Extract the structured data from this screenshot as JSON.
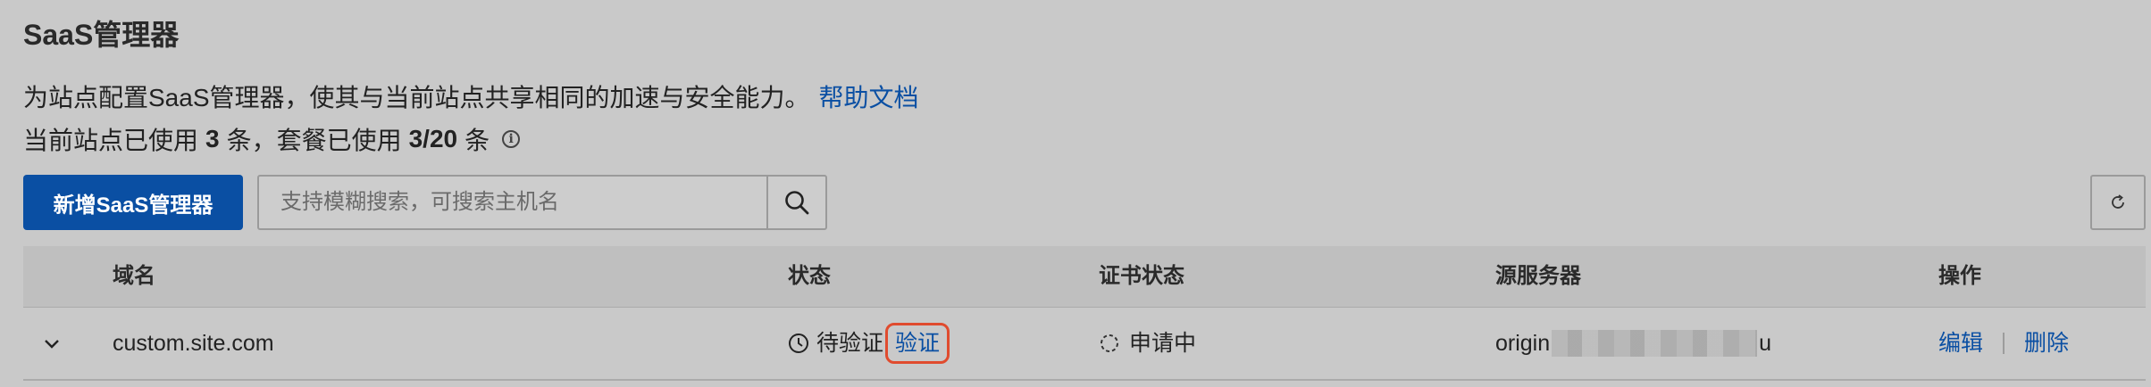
{
  "page": {
    "title": "SaaS管理器",
    "description": "为站点配置SaaS管理器，使其与当前站点共享相同的加速与安全能力。",
    "help_link": "帮助文档",
    "usage": {
      "prefix": "当前站点已使用",
      "site_used": "3",
      "mid": "条，套餐已使用",
      "plan_used": "3/20",
      "suffix": "条"
    }
  },
  "toolbar": {
    "add_button": "新增SaaS管理器",
    "search_placeholder": "支持模糊搜索，可搜索主机名"
  },
  "table": {
    "headers": {
      "domain": "域名",
      "status": "状态",
      "cert_status": "证书状态",
      "origin": "源服务器",
      "actions": "操作"
    },
    "rows": [
      {
        "domain": "custom.site.com",
        "status": "待验证",
        "verify": "验证",
        "cert_status": "申请中",
        "origin_prefix": "origin",
        "origin_suffix": "u",
        "edit": "编辑",
        "delete": "删除"
      }
    ]
  }
}
